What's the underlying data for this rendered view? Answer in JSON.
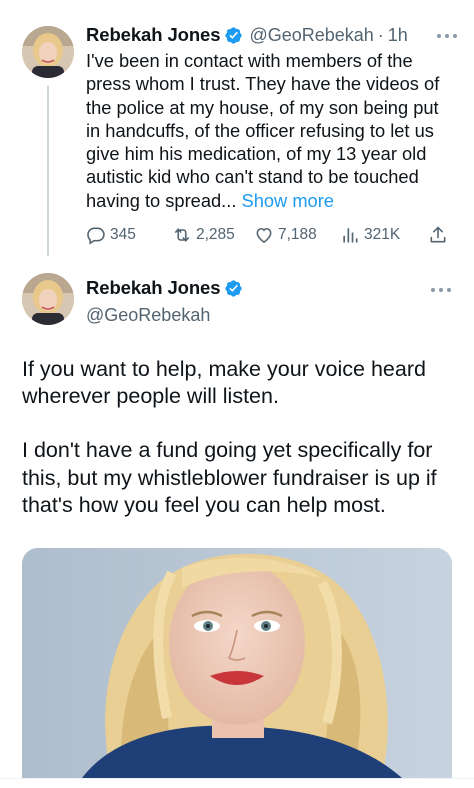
{
  "parent_tweet": {
    "display_name": "Rebekah Jones",
    "handle": "@GeoRebekah",
    "separator": "·",
    "time": "1h",
    "text": "I've been in contact with members of the press whom I trust. They have the videos of the police at my house, of my son being put in handcuffs, of the officer refusing to let us give him his medication, of my 13 year old autistic kid who can't stand to be touched having to spread...",
    "show_more_label": "Show more",
    "metrics": {
      "replies": "345",
      "retweets": "2,285",
      "likes": "7,188",
      "views": "321K"
    }
  },
  "main_tweet": {
    "display_name": "Rebekah Jones",
    "handle": "@GeoRebekah",
    "paragraph_1": "If you want to help, make your voice heard wherever people will listen.",
    "paragraph_2": "I don't have a fund going yet specifically for this, but my whistleblower fundraiser is up if that's how you feel you can help most."
  },
  "icons": {
    "verified": "verified-badge-icon",
    "more": "more-dots-icon",
    "reply": "reply-icon",
    "retweet": "retweet-icon",
    "like": "heart-icon",
    "views": "views-bar-icon",
    "share": "share-icon"
  },
  "colors": {
    "accent": "#1d9bf0",
    "secondary_text": "#536471",
    "primary_text": "#0f1419"
  }
}
